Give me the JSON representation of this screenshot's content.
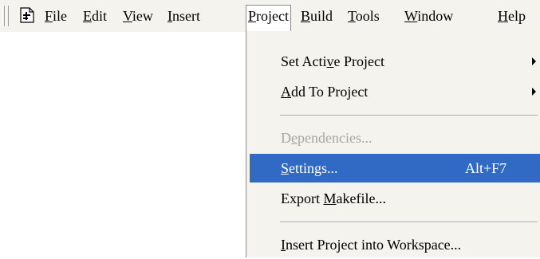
{
  "menubar": {
    "items": [
      {
        "pre": "",
        "ul": "F",
        "post": "ile"
      },
      {
        "pre": "",
        "ul": "E",
        "post": "dit"
      },
      {
        "pre": "",
        "ul": "V",
        "post": "iew"
      },
      {
        "pre": "",
        "ul": "I",
        "post": "nsert"
      },
      {
        "pre": "",
        "ul": "P",
        "post": "roject"
      },
      {
        "pre": "",
        "ul": "B",
        "post": "uild"
      },
      {
        "pre": "",
        "ul": "T",
        "post": "ools"
      },
      {
        "pre": "",
        "ul": "W",
        "post": "indow"
      },
      {
        "pre": "",
        "ul": "H",
        "post": "elp"
      }
    ],
    "icon": "document-icon",
    "active_item": "Project"
  },
  "dropdown": {
    "items": [
      {
        "pre": "Set Acti",
        "ul": "v",
        "post": "e Project",
        "submenu": true,
        "state": "normal"
      },
      {
        "pre": "",
        "ul": "A",
        "post": "dd To Project",
        "submenu": true,
        "state": "normal"
      },
      {
        "pre": "D",
        "ul": "e",
        "post": "pendencies...",
        "submenu": false,
        "state": "disabled"
      },
      {
        "pre": "",
        "ul": "S",
        "post": "ettings...",
        "shortcut": "Alt+F7",
        "submenu": false,
        "state": "highlighted"
      },
      {
        "pre": "Export ",
        "ul": "M",
        "post": "akefile...",
        "submenu": false,
        "state": "normal"
      },
      {
        "pre": "",
        "ul": "I",
        "post": "nsert Project into Workspace...",
        "submenu": false,
        "state": "normal"
      }
    ]
  },
  "colors": {
    "menubar_bg": "#f4f3ee",
    "highlight_bg": "#316ac5",
    "highlight_text": "#ffffff",
    "disabled_text": "#a7a69f"
  }
}
